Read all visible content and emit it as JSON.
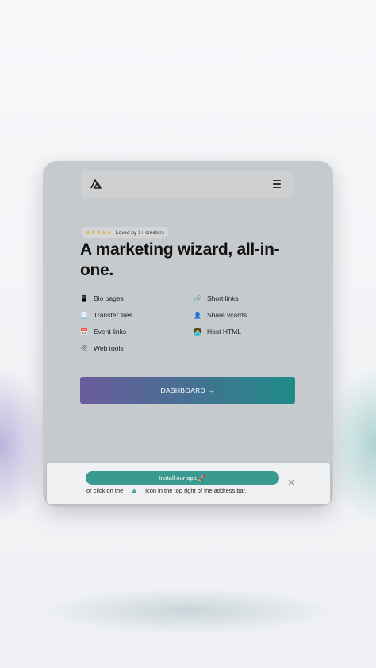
{
  "nav": {
    "logo_icon": "logo-mark-icon",
    "menu_icon": "hamburger-menu-icon"
  },
  "badge": {
    "stars": "★★★★★",
    "text": "Loved by 1+ creators"
  },
  "hero": {
    "headline": "A marketing wizard, all-in-one."
  },
  "features": [
    {
      "icon": "📱",
      "icon_name": "mobile-phone-icon",
      "label": "Bio pages"
    },
    {
      "icon": "🔗",
      "icon_name": "link-icon",
      "label": "Short links"
    },
    {
      "icon": "📃",
      "icon_name": "document-icon",
      "label": "Transfer files"
    },
    {
      "icon": "👤",
      "icon_name": "person-icon",
      "label": "Share vcards"
    },
    {
      "icon": "📅",
      "icon_name": "calendar-icon",
      "label": "Event links"
    },
    {
      "icon": "👩‍💻",
      "icon_name": "technologist-icon",
      "label": "Host HTML"
    },
    {
      "icon": "🛠",
      "icon_name": "tools-icon",
      "label": "Web tools"
    }
  ],
  "cta": {
    "label": "DASHBOARD →"
  },
  "install": {
    "button_label": "Install our app 🚀",
    "note_before": "or click on the",
    "note_after": "icon in the top right of the address bar.",
    "share_icon": "⏏",
    "close_icon": "✕"
  },
  "colors": {
    "accent": "#3a9a8f",
    "gradient_start": "#6b5c9c",
    "gradient_end": "#1f8a88",
    "star": "#e0a614"
  }
}
